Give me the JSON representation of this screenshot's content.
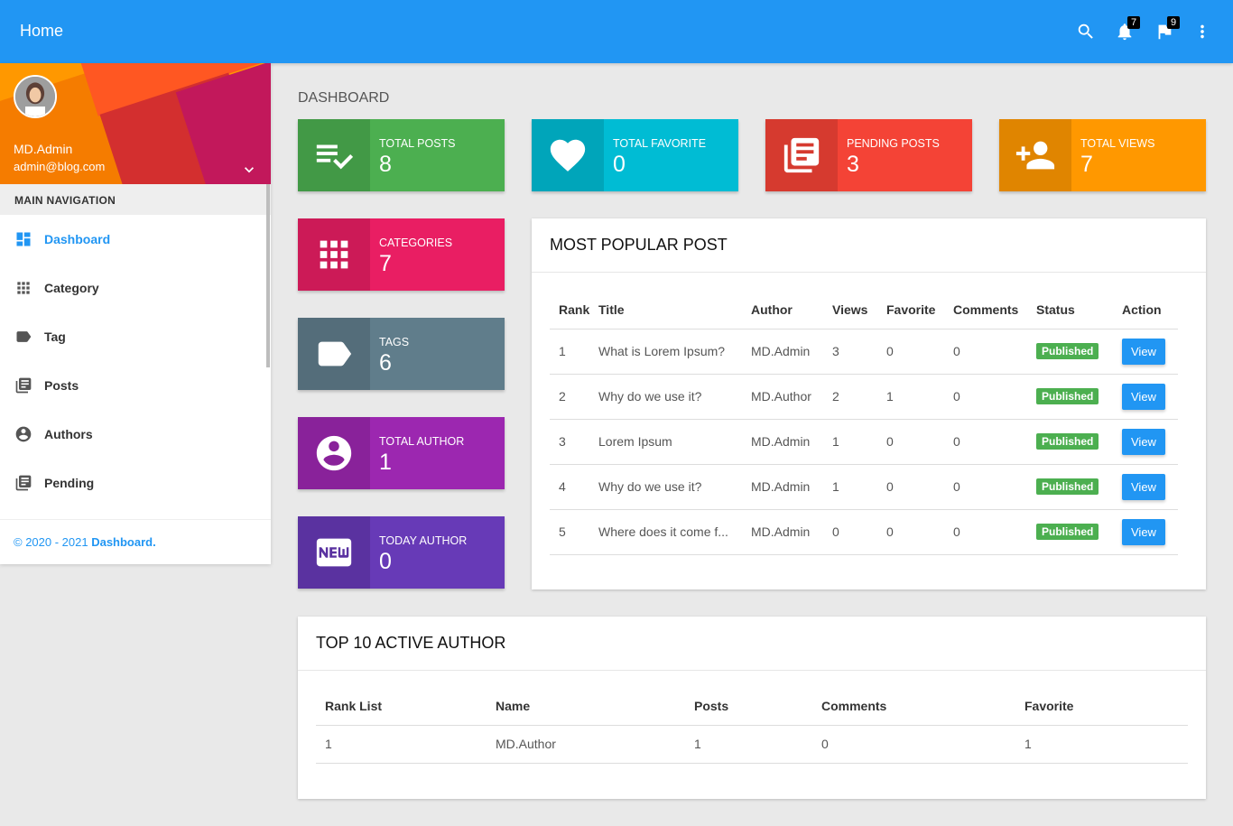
{
  "topbar": {
    "title": "Home",
    "notifications_count": "7",
    "flags_count": "9",
    "icons": [
      "search-icon",
      "bell-icon",
      "flag-icon",
      "more-vert-icon"
    ],
    "color": "#2196f3"
  },
  "user": {
    "name": "MD.Admin",
    "email": "admin@blog.com"
  },
  "sidebar": {
    "header": "MAIN NAVIGATION",
    "items": [
      {
        "label": "Dashboard",
        "icon": "dashboard-icon",
        "active": true
      },
      {
        "label": "Category",
        "icon": "apps-icon"
      },
      {
        "label": "Tag",
        "icon": "label-icon"
      },
      {
        "label": "Posts",
        "icon": "library-books-icon"
      },
      {
        "label": "Authors",
        "icon": "account-circle-icon"
      },
      {
        "label": "Pending",
        "icon": "library-books-icon"
      }
    ],
    "footer": "© 2020 - 2021 ",
    "footer_link": "Dashboard."
  },
  "dashboard": {
    "title": "DASHBOARD",
    "stats": [
      {
        "label": "TOTAL POSTS",
        "value": "8",
        "icon": "playlist-add-check-icon",
        "color": "#4caf50"
      },
      {
        "label": "TOTAL FAVORITE",
        "value": "0",
        "icon": "favorite-icon",
        "color": "#00bcd4"
      },
      {
        "label": "PENDING POSTS",
        "value": "3",
        "icon": "library-books-icon",
        "color": "#f44336"
      },
      {
        "label": "TOTAL VIEWS",
        "value": "7",
        "icon": "person-add-icon",
        "color": "#ff9800"
      },
      {
        "label": "CATEGORIES",
        "value": "7",
        "icon": "apps-icon",
        "color": "#e91e63"
      },
      {
        "label": "TAGS",
        "value": "6",
        "icon": "label-icon",
        "color": "#607d8b"
      },
      {
        "label": "TOTAL AUTHOR",
        "value": "1",
        "icon": "account-circle-icon",
        "color": "#9c27b0"
      },
      {
        "label": "TODAY AUTHOR",
        "value": "0",
        "icon": "fiber-new-icon",
        "color": "#673ab7"
      }
    ]
  },
  "popular": {
    "title": "MOST POPULAR POST",
    "columns": [
      "Rank",
      "Title",
      "Author",
      "Views",
      "Favorite",
      "Comments",
      "Status",
      "Action"
    ],
    "rows": [
      {
        "rank": "1",
        "title": "What is Lorem Ipsum?",
        "author": "MD.Admin",
        "views": "3",
        "favorite": "0",
        "comments": "0",
        "status": "Published",
        "action": "View"
      },
      {
        "rank": "2",
        "title": "Why do we use it?",
        "author": "MD.Author",
        "views": "2",
        "favorite": "1",
        "comments": "0",
        "status": "Published",
        "action": "View"
      },
      {
        "rank": "3",
        "title": "Lorem Ipsum",
        "author": "MD.Admin",
        "views": "1",
        "favorite": "0",
        "comments": "0",
        "status": "Published",
        "action": "View"
      },
      {
        "rank": "4",
        "title": "Why do we use it?",
        "author": "MD.Admin",
        "views": "1",
        "favorite": "0",
        "comments": "0",
        "status": "Published",
        "action": "View"
      },
      {
        "rank": "5",
        "title": "Where does it come f...",
        "author": "MD.Admin",
        "views": "0",
        "favorite": "0",
        "comments": "0",
        "status": "Published",
        "action": "View"
      }
    ]
  },
  "authors": {
    "title": "TOP 10 ACTIVE AUTHOR",
    "columns": [
      "Rank List",
      "Name",
      "Posts",
      "Comments",
      "Favorite"
    ],
    "rows": [
      {
        "rank": "1",
        "name": "MD.Author",
        "posts": "1",
        "comments": "0",
        "favorite": "1"
      }
    ]
  }
}
